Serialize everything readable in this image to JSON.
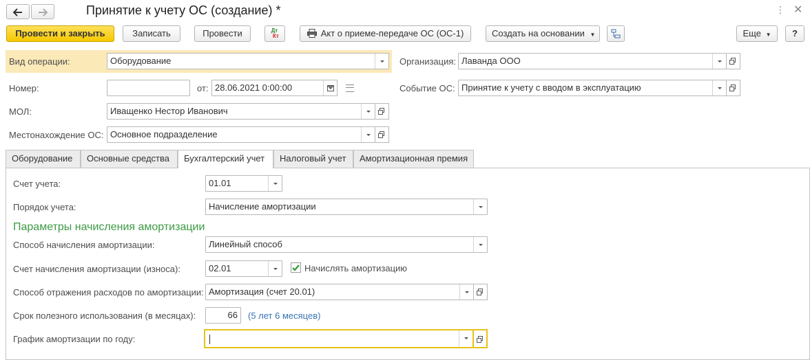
{
  "title": "Принятие к учету ОС (создание) *",
  "toolbar": {
    "post_close": "Провести и закрыть",
    "save": "Записать",
    "post": "Провести",
    "dtkt_top": "Дт",
    "dtkt_bottom": "Кт",
    "act": "Акт о приеме-передаче ОС (ОС-1)",
    "create_based": "Создать на основании",
    "more": "Еще",
    "help": "?"
  },
  "header": {
    "op_type_label": "Вид операции:",
    "op_type_value": "Оборудование",
    "org_label": "Организация:",
    "org_value": "Лаванда ООО",
    "number_label": "Номер:",
    "number_value": "",
    "from_label": "от:",
    "date_value": "28.06.2021  0:00:00",
    "event_label": "Событие ОС:",
    "event_value": "Принятие к учету с вводом в эксплуатацию",
    "mol_label": "МОЛ:",
    "mol_value": "Иващенко Нестор Иванович",
    "location_label": "Местонахождение ОС:",
    "location_value": "Основное подразделение"
  },
  "tabs": [
    {
      "label": "Оборудование"
    },
    {
      "label": "Основные средства"
    },
    {
      "label": "Бухгалтерский учет"
    },
    {
      "label": "Налоговый учет"
    },
    {
      "label": "Амортизационная премия"
    }
  ],
  "active_tab": 2,
  "accounting": {
    "account_label": "Счет учета:",
    "account_value": "01.01",
    "order_label": "Порядок учета:",
    "order_value": "Начисление амортизации",
    "params_heading": "Параметры начисления амортизации",
    "method_label": "Способ начисления амортизации:",
    "method_value": "Линейный способ",
    "dep_account_label": "Счет начисления амортизации (износа):",
    "dep_account_value": "02.01",
    "accrue_label": "Начислять амортизацию",
    "accrue_checked": true,
    "expense_label": "Способ отражения расходов по амортизации:",
    "expense_value": "Амортизация (счет 20.01)",
    "life_label": "Срок полезного использования (в месяцах):",
    "life_value": "66",
    "life_hint": "(5 лет 6 месяцев)",
    "schedule_label": "График амортизации по году:",
    "schedule_value": ""
  },
  "colors": {
    "primary_button": "#f5c800",
    "highlight_row": "#fbe9b8",
    "section_heading": "#3c9a44",
    "focus_border": "#e6c21a",
    "link": "#3a74b4"
  }
}
